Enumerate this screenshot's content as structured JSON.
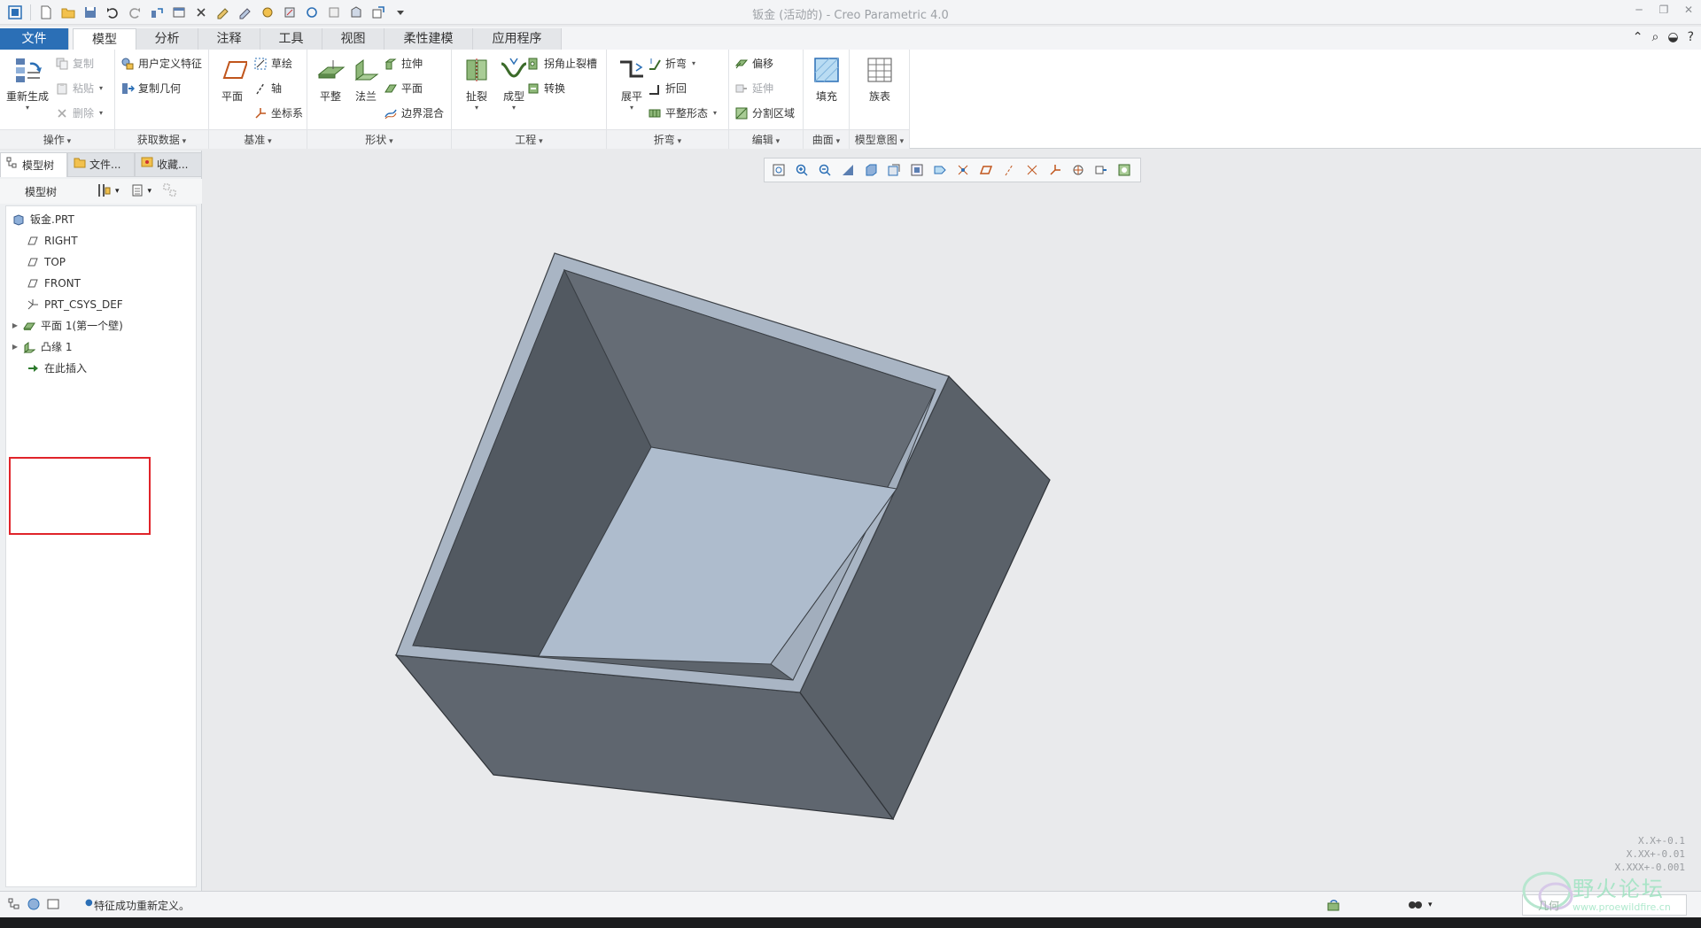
{
  "window": {
    "title": "钣金 (活动的) - Creo Parametric 4.0"
  },
  "tabs": [
    {
      "label": "文件"
    },
    {
      "label": "模型"
    },
    {
      "label": "分析"
    },
    {
      "label": "注释"
    },
    {
      "label": "工具"
    },
    {
      "label": "视图"
    },
    {
      "label": "柔性建模"
    },
    {
      "label": "应用程序"
    }
  ],
  "ribbon": {
    "operations": {
      "label": "操作",
      "regenerate": "重新生成",
      "copy": "复制",
      "paste": "粘贴",
      "delete": "删除"
    },
    "get_data": {
      "label": "获取数据",
      "udf": "用户定义特征",
      "copy_geom": "复制几何"
    },
    "datum": {
      "label": "基准",
      "plane": "平面",
      "sketch": "草绘",
      "axis": "轴",
      "csys": "坐标系"
    },
    "shapes": {
      "label": "形状",
      "planar": "平整",
      "flange": "法兰",
      "extrude": "拉伸",
      "flat": "平面",
      "boundary_blend": "边界混合"
    },
    "engineering": {
      "label": "工程",
      "rip": "扯裂",
      "form": "成型",
      "corner_relief": "拐角止裂槽",
      "convert": "转换"
    },
    "bends": {
      "label": "折弯",
      "unbend": "展平",
      "bend": "折弯",
      "bend_back": "折回",
      "flat_state": "平整形态"
    },
    "editing": {
      "label": "编辑",
      "offset": "偏移",
      "extend": "延伸",
      "split_area": "分割区域"
    },
    "surfaces": {
      "label": "曲面",
      "fill": "填充"
    },
    "model_intent": {
      "label": "模型意图",
      "family_table": "族表"
    }
  },
  "panel": {
    "tabs": [
      {
        "label": "模型树"
      },
      {
        "label": "文件..."
      },
      {
        "label": "收藏..."
      }
    ],
    "toolbar_label": "模型树",
    "tree": [
      {
        "label": "钣金.PRT",
        "icon": "part-icon"
      },
      {
        "label": "RIGHT",
        "icon": "datum-plane-icon"
      },
      {
        "label": "TOP",
        "icon": "datum-plane-icon"
      },
      {
        "label": "FRONT",
        "icon": "datum-plane-icon"
      },
      {
        "label": "PRT_CSYS_DEF",
        "icon": "csys-icon"
      },
      {
        "label": "平面 1(第一个壁)",
        "icon": "planar-wall-icon"
      },
      {
        "label": "凸缘 1",
        "icon": "flange-icon"
      },
      {
        "label": "在此插入",
        "icon": "insert-arrow-icon"
      }
    ]
  },
  "viewport": {
    "tolerances": [
      "X.X+-0.1",
      "X.XX+-0.01",
      "X.XXX+-0.001"
    ]
  },
  "status": {
    "message": "特征成功重新定义。",
    "filter": ""
  },
  "watermark": {
    "text": "野火论坛",
    "url": "www.proewildfire.cn",
    "small": "几何"
  },
  "colors": {
    "file_tab": "#2b6fb6",
    "highlight_box": "#e0242a",
    "model_outer": "#5e646c",
    "model_floor": "#aebccd",
    "model_rim": "#a7b3c2"
  }
}
